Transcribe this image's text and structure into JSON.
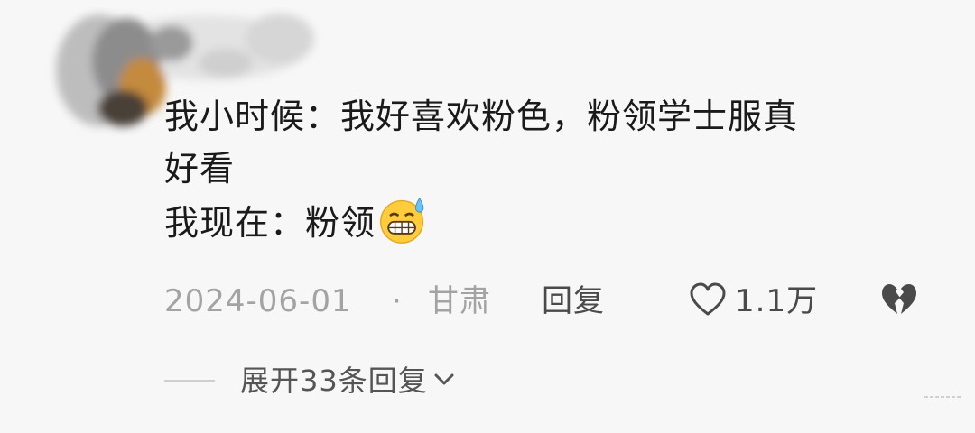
{
  "comment": {
    "lines": [
      "我小时候：我好喜欢粉色，粉领学士服真",
      "好看",
      "我现在：粉领"
    ],
    "emoji_icon": "grimacing-sweat-emoji"
  },
  "meta": {
    "date": "2024-06-01",
    "separator": "·",
    "location": "甘肃",
    "reply_label": "回复",
    "like_count": "1.1万",
    "like_icon": "heart-outline-icon",
    "dislike_icon": "broken-heart-icon"
  },
  "replies": {
    "expand_label": "展开33条回复",
    "expand_icon": "chevron-down-icon"
  },
  "colors": {
    "background": "#f7f7f7",
    "text_primary": "#1a1a1a",
    "text_secondary": "#a3a3a3",
    "text_action": "#4a4a4a"
  }
}
